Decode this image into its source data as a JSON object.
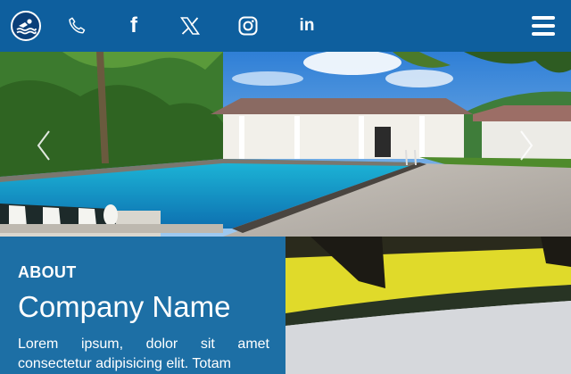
{
  "header": {
    "icons": [
      "swimmer-logo-icon",
      "phone-icon",
      "facebook-icon",
      "x-twitter-icon",
      "instagram-icon",
      "linkedin-icon",
      "hamburger-menu-icon"
    ],
    "social": {
      "facebook_glyph": "f",
      "linkedin_glyph": "in"
    },
    "colors": {
      "bar": "#0e5f9e",
      "icon": "#ffffff"
    }
  },
  "hero": {
    "carousel_controls": [
      "chevron-left-icon",
      "chevron-right-icon"
    ]
  },
  "about": {
    "label": "ABOUT",
    "title": "Company Name",
    "body": "Lorem ipsum, dolor sit amet consectetur adipisicing elit. Totam",
    "colors": {
      "panel": "#1d6fa5"
    }
  }
}
